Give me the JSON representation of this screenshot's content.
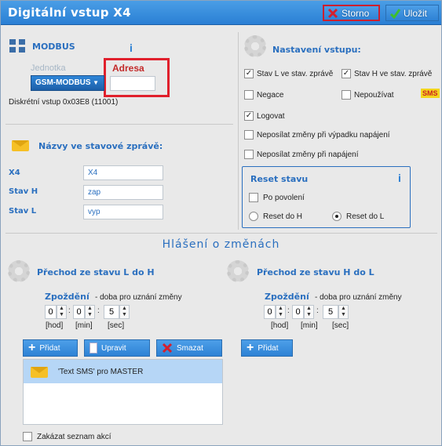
{
  "window": {
    "title": "Digitální vstup X4",
    "storno_label": "Storno",
    "ulozit_label": "Uložit"
  },
  "modbus": {
    "title": "MODBUS",
    "info": "i",
    "jednotka_label": "Jednotka",
    "adresa_label": "Adresa",
    "device_value": "GSM-MODBUS",
    "adresa_value": "",
    "address_note": "Diskrétní vstup 0x03E8 (11001)"
  },
  "nazvy": {
    "title": "Názvy ve stavové zprávě:",
    "rows": [
      {
        "label": "X4",
        "value": "X4"
      },
      {
        "label": "Stav H",
        "value": "zap"
      },
      {
        "label": "Stav L",
        "value": "vyp"
      }
    ]
  },
  "nastaveni": {
    "title": "Nastavení vstupu:",
    "stav_l": "Stav L ve stav. zprávě",
    "stav_h": "Stav H ve stav. zprávě",
    "negace": "Negace",
    "nepouzivat": "Nepoužívat",
    "sms_badge": "SMS",
    "logovat": "Logovat",
    "neposilat_vypadek": "Neposílat změny při výpadku napájení",
    "neposilat_napajeni": "Neposílat změny při napájení"
  },
  "reset": {
    "title": "Reset stavu",
    "info": "i",
    "po_povoleni": "Po povolení",
    "reset_h": "Reset do H",
    "reset_l": "Reset do L"
  },
  "hlaseni": {
    "title": "Hlášení o změnách",
    "left": {
      "title": "Přechod ze stavu L do H",
      "zpozdeni": "Zpoždění",
      "zpozdeni_note": "- doba pro uznání změny",
      "hod": "0",
      "min": "0",
      "sec": "5",
      "unit_hod": "[hod]",
      "unit_min": "[min]",
      "unit_sec": "[sec]"
    },
    "right": {
      "title": "Přechod ze stavu H do L",
      "zpozdeni": "Zpoždění",
      "zpozdeni_note": "- doba pro uznání změny",
      "hod": "0",
      "min": "0",
      "sec": "5",
      "unit_hod": "[hod]",
      "unit_min": "[min]",
      "unit_sec": "[sec]"
    },
    "pridat": "Přidat",
    "upravit": "Upravit",
    "smazat": "Smazat",
    "pridat_right": "Přidat",
    "list_item": "'Text SMS' pro MASTER",
    "zakazat": "Zakázat seznam akcí"
  }
}
